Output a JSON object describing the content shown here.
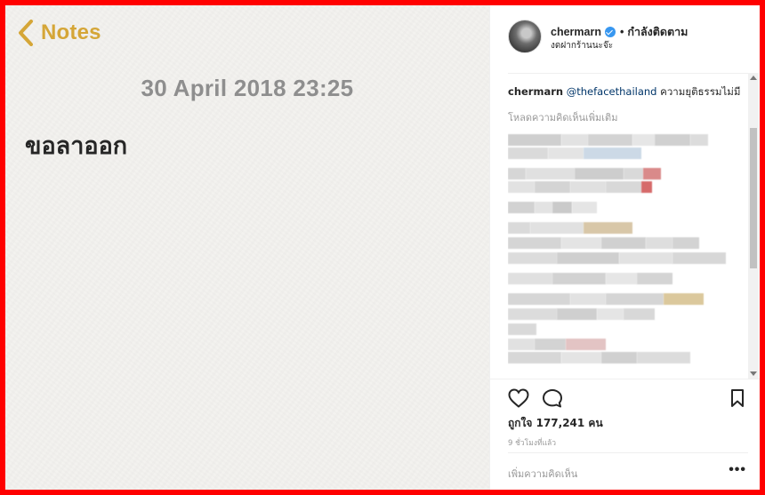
{
  "notes": {
    "back_label": "Notes",
    "date": "30 April 2018 23:25",
    "body": "ขอลาออก"
  },
  "post": {
    "username": "chermarn",
    "follow_status": "กำลังติดตาม",
    "location": "งดฝากร้านนะจ๊ะ",
    "caption": {
      "username": "chermarn",
      "mention": "@thefacethailand",
      "text": " ความยุติธรรมไม่มี"
    },
    "load_more": "โหลดความคิดเห็นเพิ่มเติม",
    "likes": "ถูกใจ 177,241 คน",
    "time_ago": "9 ชั่วโมงที่แล้ว",
    "add_comment_placeholder": "เพิ่มความคิดเห็น",
    "more": "•••"
  },
  "icons": [
    "chevron-left-icon",
    "verified-icon",
    "heart-icon",
    "comment-icon",
    "bookmark-icon",
    "more-options-icon"
  ],
  "colors": {
    "notes_accent": "#d5a637",
    "mention": "#003569",
    "verified": "#3897f0",
    "frame": "#ff0000"
  }
}
